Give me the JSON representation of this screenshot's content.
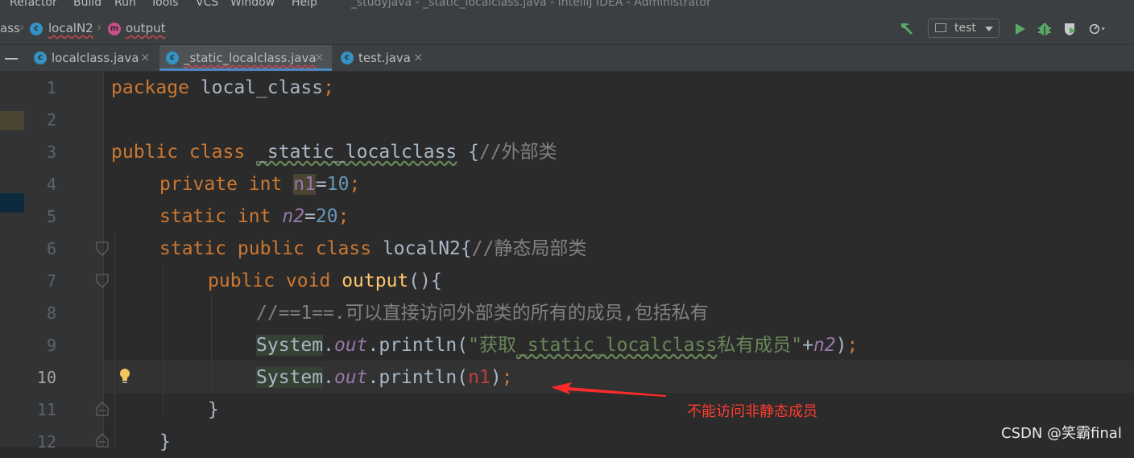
{
  "menu": {
    "items": [
      "Refactor",
      "Build",
      "Run",
      "Tools",
      "VCS",
      "Window",
      "Help"
    ],
    "window_title": "_studyjava - _static_localclass.java - IntelliJ IDEA - Administrator"
  },
  "breadcrumb": {
    "items": [
      {
        "label": "ass",
        "icon": "none"
      },
      {
        "label": "localN2",
        "icon": "class-icon"
      },
      {
        "label": "output",
        "icon": "method-icon"
      }
    ]
  },
  "toolbar": {
    "run_config": "test",
    "buttons": [
      "build-hammer-icon",
      "run-icon",
      "debug-icon",
      "coverage-icon",
      "profile-icon"
    ]
  },
  "tabs": [
    {
      "label": "localclass.java",
      "active": false
    },
    {
      "label": "_static_localclass.java",
      "active": true
    },
    {
      "label": "test.java",
      "active": false
    }
  ],
  "editor": {
    "current_line": 10,
    "line_numbers": [
      "1",
      "2",
      "3",
      "4",
      "5",
      "6",
      "7",
      "8",
      "9",
      "10",
      "11",
      "12"
    ],
    "code": {
      "l1_kw": "package",
      "l1_rest": " local_class",
      "l1_semi": ";",
      "l3_kw": "public class",
      "l3_name": "_static_localclass",
      "l3_rest": " {",
      "l3_cmt": "//外部类",
      "l4_kw": "private int",
      "l4_var": "n1",
      "l4_eq": "=",
      "l4_num": "10",
      "l4_semi": ";",
      "l5_kw": "static int",
      "l5_var": "n2",
      "l5_eq": "=",
      "l5_num": "20",
      "l5_semi": ";",
      "l6_kw": "static public class",
      "l6_rest": " localN2{",
      "l6_cmt": "//静态局部类",
      "l7_kw": "public void",
      "l7_fn": "output",
      "l7_rest": "(){",
      "l8_cmt": "//==1==.可以直接访问外部类的所有的成员,包括私有",
      "l9_sys": "System",
      "l9_dot": ".",
      "l9_out": "out",
      "l9_call": ".println(",
      "l9_str1": "\"获取",
      "l9_str2": "_static_localclass",
      "l9_str3": "私有成员\"",
      "l9_plus": "+",
      "l9_var": "n2",
      "l9_end": ")",
      "l9_semi": ";",
      "l10_sys": "System",
      "l10_dot": ".",
      "l10_out": "out",
      "l10_call": ".println(",
      "l10_var": "n1",
      "l10_end": ")",
      "l10_semi": ";",
      "l11": "}",
      "l12": "}"
    }
  },
  "annotation": {
    "text": "不能访问非静态成员",
    "color": "#ff3b30"
  },
  "watermark": "CSDN @笑霸final",
  "colors": {
    "keyword": "#cc7832",
    "number": "#6897bb",
    "field": "#9876aa",
    "method": "#ffc66d",
    "comment": "#808080",
    "string": "#6a8759",
    "error": "#bc3f3c",
    "background": "#2b2b2b"
  }
}
